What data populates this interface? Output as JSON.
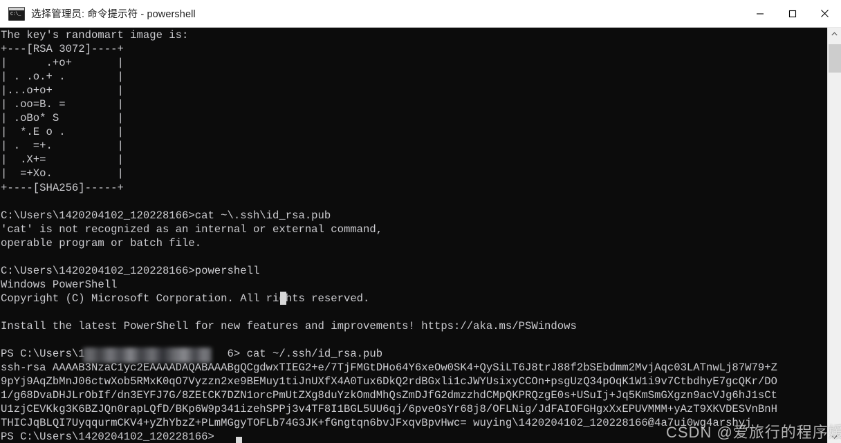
{
  "window": {
    "title": "选择管理员: 命令提示符 - powershell",
    "icon_name": "cmd-icon",
    "icon_prompt_text": "C:\\_",
    "minimize_label": "Minimize",
    "maximize_label": "Maximize",
    "close_label": "Close"
  },
  "scrollbar": {
    "up_arrow": "˄",
    "down_arrow": "˅"
  },
  "terminal": {
    "text": "The key's randomart image is:\n+---[RSA 3072]----+\n|      .+o+       |\n| . .o.+ .        |\n|...o+o+          |\n| .oo=B. =        |\n| .oBo* S         |\n|  *.E o .        |\n| .  =+.          |\n|  .X+=           |\n|  =+Xo.          |\n+----[SHA256]-----+\n\nC:\\Users\\1420204102_120228166>cat ~\\.ssh\\id_rsa.pub\n'cat' is not recognized as an internal or external command,\noperable program or batch file.\n\nC:\\Users\\1420204102_120228166>powershell\nWindows PowerShell\nCopyright (C) Microsoft Corporation. All rights reserved.\n\nInstall the latest PowerShell for new features and improvements! https://aka.ms/PSWindows\n\nPS C:\\Users\\1                      6> cat ~/.ssh/id_rsa.pub\nssh-rsa AAAAB3NzaC1yc2EAAAADAQABAAABgQCgdwxTIEG2+e/7TjFMGtDHo64Y6xeOw0SK4+QySiLT6J8trJ88f2bSEbdmm2MvjAqc03LATnwLj87W79+Z\n9pYj9AqZbMnJ06ctwXob5RMxK0qO7Vyzzn2xe9BEMuy1tiJnUXfX4A0Tux6DkQ2rdBGxli1cJWYUsixyCCOn+psgUzQ34pOqK1W1i9v7CtbdhyE7gcQKr/DO\n1/g68DvaDHJLrObIf/dn3EYFJ7G/8ZEtCK7DZN1orcPmUtZXg8duYzkOmdMhQsZmDJfG2dmzzhdCMpQKPRQzgE0s+USuIj+Jq5KmSmGXgzn9acVJg6hJ1sCt\nU1zjCEVKkg3K6BZJQn0rapLQfD/BKp6W9p341izehSPPj3v4TF8I1BGL5UU6qj/6pveOsYr68j8/OFLNig/JdFAIOFGHgxXxEPUVMMM+yAzT9XKVDESVnBnH\nTHICJqBLQI7UyqqurmCKV4+yZhYbzZ+PLmMGgyTOFLb74G3JK+fGngtqn6bvJFxqvBpvHwc= wuying\\1420204102_120228166@4a7ui0wg4arshyj\nPS C:\\Users\\1420204102_120228166>"
  },
  "redaction": {
    "label": "redacted-username"
  },
  "watermark": {
    "text": "CSDN @爱旅行的程序媛"
  }
}
